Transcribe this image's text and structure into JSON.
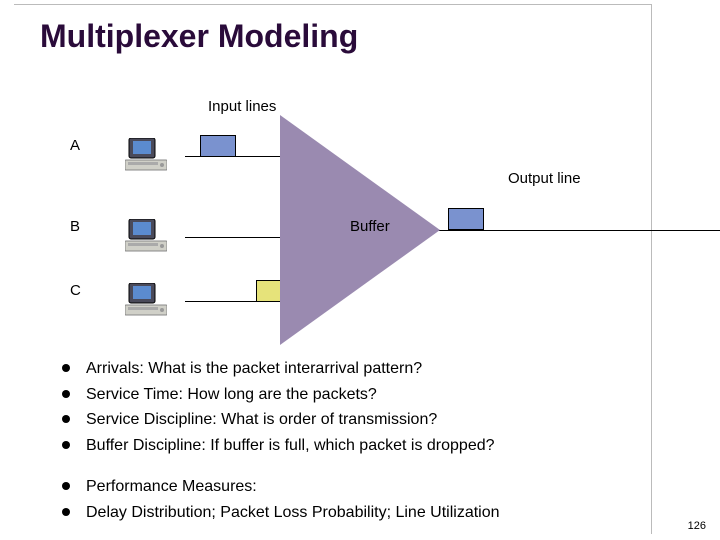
{
  "title": "Multiplexer Modeling",
  "labels": {
    "input_lines": "Input lines",
    "a": "A",
    "b": "B",
    "c": "C",
    "buffer": "Buffer",
    "output": "Output line"
  },
  "bullets1": [
    "Arrivals:  What is the packet interarrival pattern?",
    "Service Time:  How long are the packets?",
    "Service Discipline:  What is order of transmission?",
    "Buffer Discipline:  If buffer is full, which packet is dropped?"
  ],
  "bullets2": [
    "Performance Measures:",
    "Delay Distribution;  Packet Loss Probability;  Line Utilization"
  ],
  "page": "126"
}
